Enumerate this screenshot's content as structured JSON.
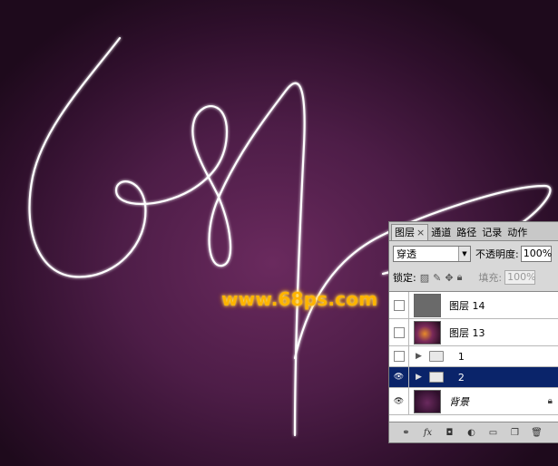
{
  "watermark": "www.68ps.com",
  "colors": {
    "background_center": "#6a2a5e",
    "background_edge": "#1e0a1c",
    "stroke": "#ffffff",
    "watermark": "#ffb400",
    "selection": "#0a246a"
  },
  "panel": {
    "tabs": [
      {
        "label": "图层",
        "close": "×"
      },
      {
        "label": "通道"
      },
      {
        "label": "路径"
      },
      {
        "label": "记录"
      },
      {
        "label": "动作"
      }
    ],
    "blend_mode": "穿透",
    "opacity_label": "不透明度:",
    "opacity_value": "100%",
    "lock_label": "锁定:",
    "fill_label": "填充:",
    "fill_value": "100%",
    "layers": [
      {
        "name": "图层 14",
        "visible": false,
        "kind": "layer"
      },
      {
        "name": "图层 13",
        "visible": false,
        "kind": "layer"
      },
      {
        "name": "1",
        "visible": false,
        "kind": "group"
      },
      {
        "name": "2",
        "visible": true,
        "kind": "group",
        "selected": true
      },
      {
        "name": "背景",
        "visible": true,
        "kind": "background",
        "locked": true
      }
    ],
    "bottom_icons": [
      "link-icon",
      "fx-icon",
      "mask-icon",
      "adjustment-icon",
      "new-group-icon",
      "new-layer-icon",
      "trash-icon"
    ]
  }
}
